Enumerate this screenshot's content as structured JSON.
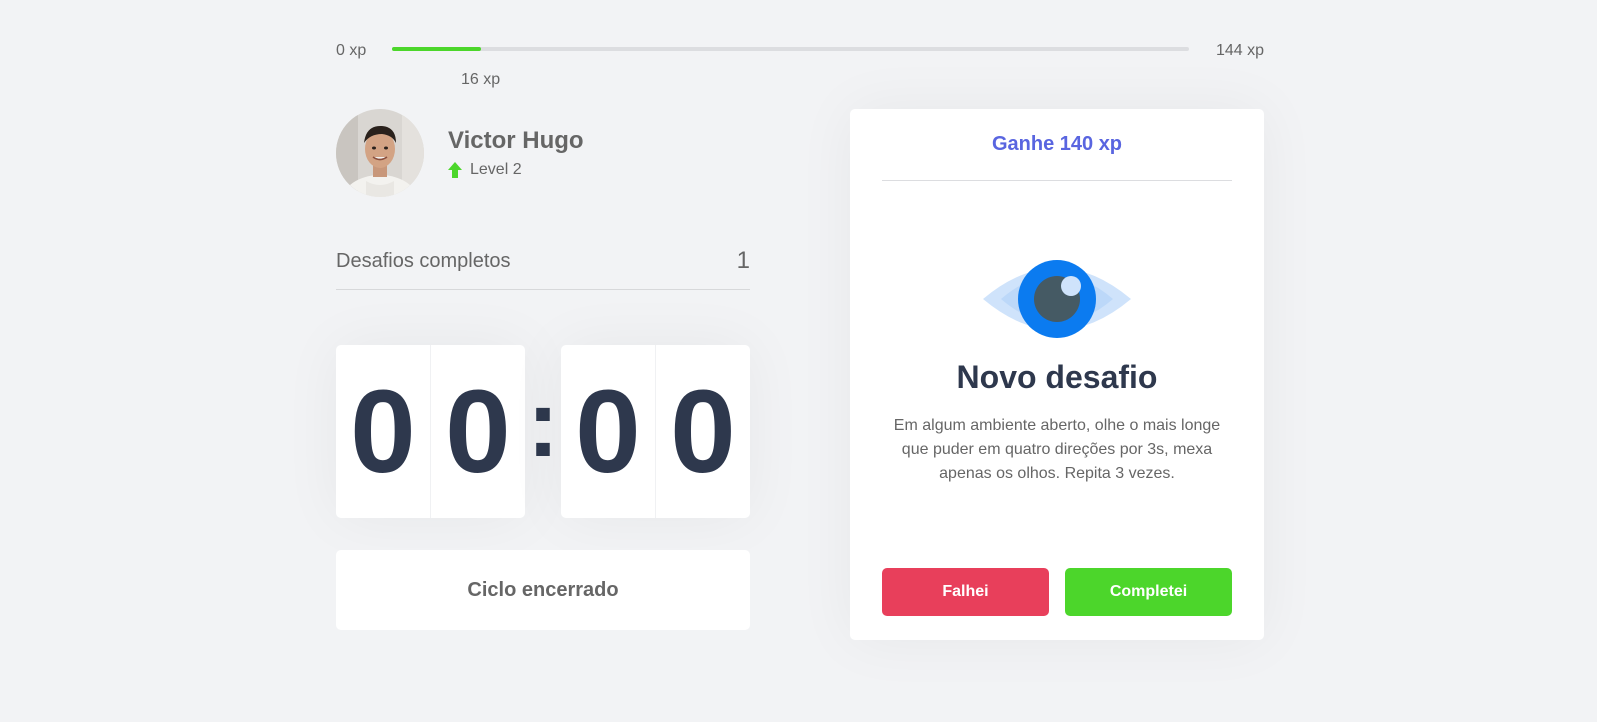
{
  "experience": {
    "min_label": "0 xp",
    "max_label": "144 xp",
    "current_label": "16 xp",
    "current_value": 16,
    "max_value": 144
  },
  "profile": {
    "name": "Victor Hugo",
    "level_label": "Level 2"
  },
  "completed_challenges": {
    "label": "Desafios completos",
    "count": "1"
  },
  "countdown": {
    "minute_left": "0",
    "minute_right": "0",
    "separator": ":",
    "second_left": "0",
    "second_right": "0"
  },
  "cycle_button": {
    "label": "Ciclo encerrado"
  },
  "challenge": {
    "reward": "Ganhe 140 xp",
    "title": "Novo desafio",
    "description": "Em algum ambiente aberto, olhe o mais longe que puder em quatro direções por 3s, mexa apenas os olhos. Repita 3 vezes.",
    "icon": "eye-icon",
    "failed_label": "Falhei",
    "succeeded_label": "Completei"
  },
  "colors": {
    "background": "#f2f3f5",
    "accent_blue": "#5965e0",
    "success_green": "#4cd62b",
    "fail_red": "#e83f5b",
    "title_dark": "#2e384d",
    "text_gray": "#666666"
  }
}
